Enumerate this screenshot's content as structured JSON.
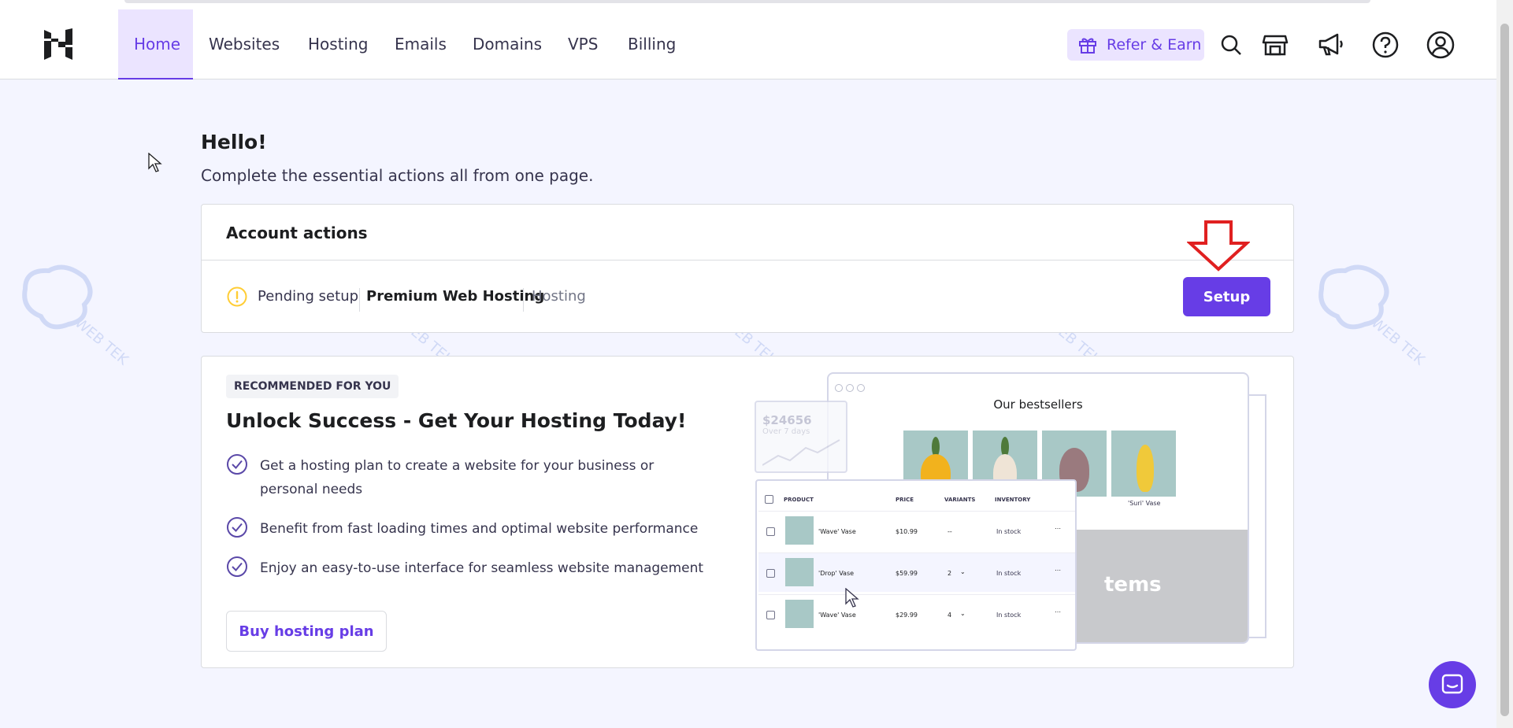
{
  "nav": {
    "items": [
      "Home",
      "Websites",
      "Hosting",
      "Emails",
      "Domains",
      "VPS",
      "Billing"
    ],
    "active": "Home",
    "refer_label": "Refer & Earn",
    "icons": [
      "search-icon",
      "store-icon",
      "megaphone-icon",
      "help-icon",
      "account-icon"
    ]
  },
  "hero": {
    "title": "Hello!",
    "subtitle": "Complete the essential actions all from one page."
  },
  "account_actions": {
    "title": "Account actions",
    "status": "Pending setup",
    "plan": "Premium Web Hosting",
    "type": "Hosting",
    "button": "Setup"
  },
  "recommendation": {
    "badge": "RECOMMENDED FOR YOU",
    "title": "Unlock Success - Get Your Hosting Today!",
    "bullets": [
      "Get a hosting plan to create a website for your business or personal needs",
      "Benefit from fast loading times and optimal website performance",
      "Enjoy an easy-to-use interface for seamless website management"
    ],
    "button": "Buy hosting plan"
  },
  "illustration": {
    "shop_title": "Our bestsellers",
    "product_labels": [
      "'Suri' Vase"
    ],
    "sales_value": "$24656",
    "sales_period": "Over 7 days",
    "items_text": "tems",
    "table_headers": [
      "PRODUCT",
      "PRICE",
      "VARIANTS",
      "INVENTORY"
    ],
    "rows": [
      {
        "name": "'Wave' Vase",
        "price": "$10.99",
        "variants": "--",
        "inventory": "In stock"
      },
      {
        "name": "'Drop' Vase",
        "price": "$59.99",
        "variants": "2",
        "inventory": "In stock"
      },
      {
        "name": "'Wave' Vase",
        "price": "$29.99",
        "variants": "4",
        "inventory": "In stock"
      }
    ]
  },
  "watermark": {
    "text": "WEB TEK"
  },
  "colors": {
    "accent": "#673de6",
    "accent_light": "#ebe4ff",
    "background": "#f4f5ff",
    "warning": "#ffcd35",
    "arrow": "#e02020"
  }
}
